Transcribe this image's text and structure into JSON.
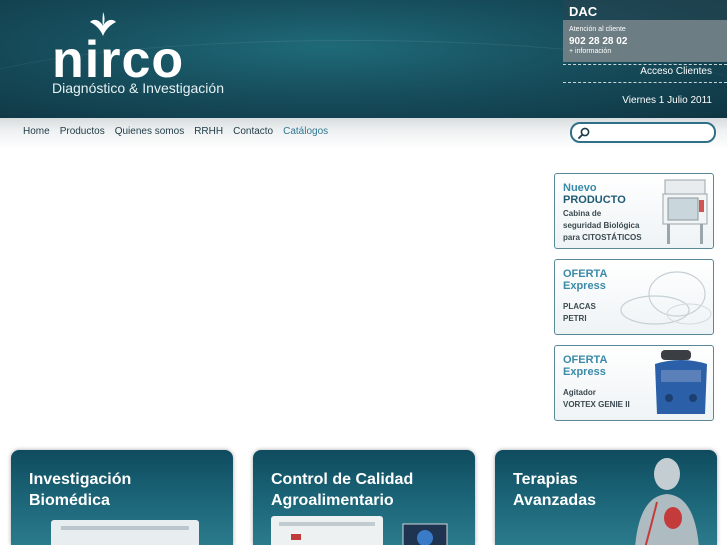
{
  "brand": {
    "name": "nirco",
    "tagline": "Diagnóstico & Investigación"
  },
  "contact": {
    "heading": "DAC",
    "attention": "Atención al cliente",
    "phone": "902 28 28 02",
    "more": "+ información"
  },
  "header": {
    "client_access": "Acceso Clientes",
    "date": "Viernes 1 Julio 2011"
  },
  "nav": {
    "items": [
      {
        "label": "Home"
      },
      {
        "label": "Productos"
      },
      {
        "label": "Quienes somos"
      },
      {
        "label": "RRHH"
      },
      {
        "label": "Contacto"
      },
      {
        "label": "Catálogos"
      }
    ]
  },
  "search": {
    "placeholder": "",
    "icon": "search-icon"
  },
  "promos": [
    {
      "line1": "Nuevo",
      "line2": "PRODUCTO",
      "desc": [
        "Cabina de",
        "seguridad Biológica",
        "para CITOSTÁTICOS"
      ]
    },
    {
      "line1": "OFERTA",
      "line2": "Express",
      "desc": [
        "PLACAS",
        "PETRI"
      ]
    },
    {
      "line1": "OFERTA",
      "line2": "Express",
      "desc": [
        "Agitador",
        "VORTEX GENIE II"
      ]
    }
  ],
  "cards": [
    {
      "line1": "Investigación",
      "line2": "Biomédica"
    },
    {
      "line1": "Control de Calidad",
      "line2": "Agroalimentario"
    },
    {
      "line1": "Terapias",
      "line2": "Avanzadas"
    }
  ],
  "colors": {
    "header_bg": "#174f5e",
    "accent": "#2f7792",
    "promo_title": "#3a8aa8",
    "card_bg": "#1b6477"
  }
}
